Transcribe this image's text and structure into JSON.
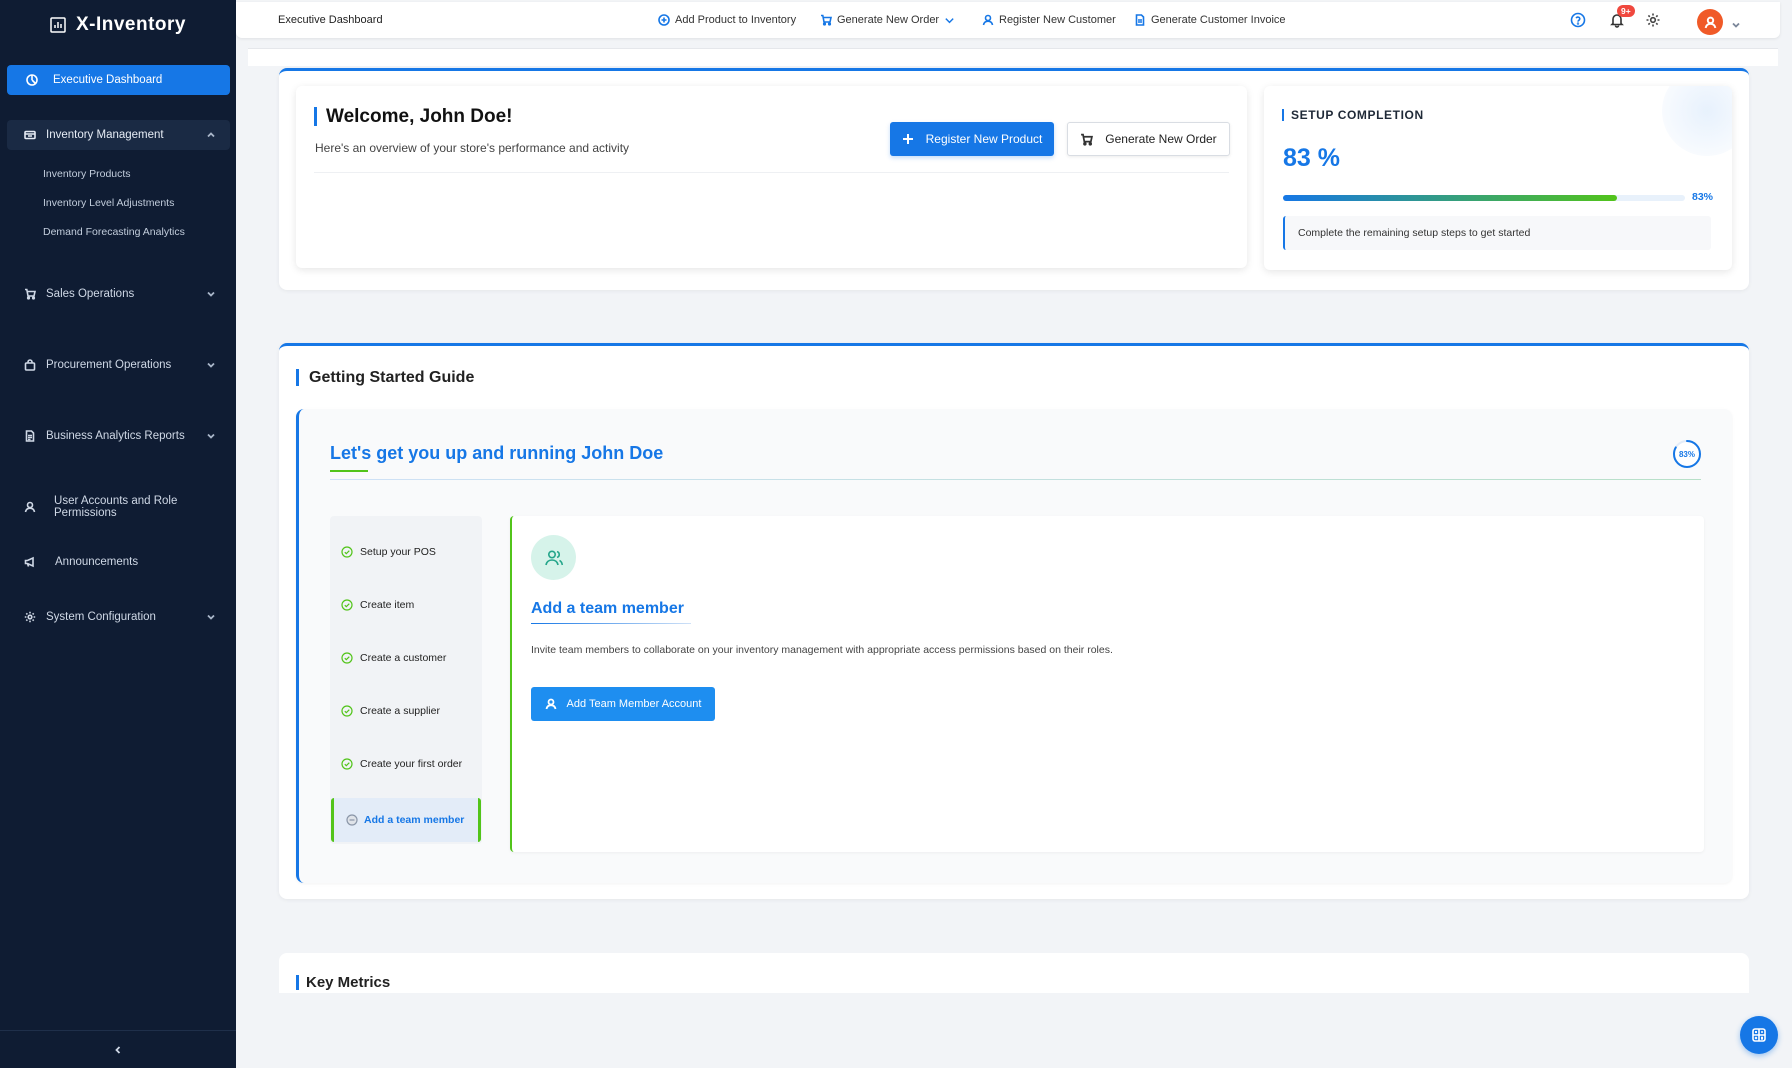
{
  "app": {
    "name": "X-Inventory"
  },
  "sidebar": {
    "active": {
      "label": "Executive Dashboard",
      "icon": "dashboard-icon"
    },
    "group": {
      "label": "Inventory Management",
      "icon": "box-icon",
      "children": [
        "Inventory Products",
        "Inventory Level Adjustments",
        "Demand Forecasting Analytics"
      ]
    },
    "items": [
      {
        "label": "Sales Operations",
        "icon": "cart-icon"
      },
      {
        "label": "Procurement Operations",
        "icon": "bag-icon"
      },
      {
        "label": "Business Analytics Reports",
        "icon": "report-icon"
      },
      {
        "label": "User Accounts and Role Permissions",
        "icon": "user-icon"
      },
      {
        "label": "Announcements",
        "icon": "megaphone-icon"
      },
      {
        "label": "System Configuration",
        "icon": "gear-icon"
      }
    ]
  },
  "topbar": {
    "page_title": "Executive Dashboard",
    "actions": [
      {
        "label": "Add Product to Inventory",
        "icon": "plus-circle-icon"
      },
      {
        "label": "Generate New Order",
        "icon": "cart-icon"
      },
      {
        "label": "Register New Customer",
        "icon": "user-icon"
      },
      {
        "label": "Generate Customer Invoice",
        "icon": "document-icon"
      }
    ],
    "notification_badge": "9+"
  },
  "welcome": {
    "title": "Welcome, John Doe!",
    "subtitle": "Here's an overview of your store's performance and activity",
    "primary_button": "Register New Product",
    "secondary_button": "Generate New Order"
  },
  "setup": {
    "title": "SETUP COMPLETION",
    "percent_text": "83 %",
    "progress": 0.83,
    "progress_label": "83%",
    "note": "Complete the remaining setup steps to get started"
  },
  "guide": {
    "section_title": "Getting Started Guide",
    "heading": "Let's get you up and running John Doe",
    "ring_label": "83%",
    "ring_value": 0.83,
    "steps": [
      {
        "label": "Setup your POS",
        "done": true
      },
      {
        "label": "Create item",
        "done": true
      },
      {
        "label": "Create a customer",
        "done": true
      },
      {
        "label": "Create a supplier",
        "done": true
      },
      {
        "label": "Create your first order",
        "done": true
      },
      {
        "label": "Add a team member",
        "done": false
      }
    ],
    "detail": {
      "title": "Add a team member",
      "description": "Invite team members to collaborate on your inventory management with appropriate access permissions based on their roles.",
      "button": "Add Team Member Account"
    }
  },
  "metrics": {
    "title": "Key Metrics"
  },
  "colors": {
    "primary": "#1677e6",
    "success": "#52c41a",
    "sidebar": "#0f1c33",
    "danger": "#f0483e",
    "avatar": "#f05a28"
  }
}
